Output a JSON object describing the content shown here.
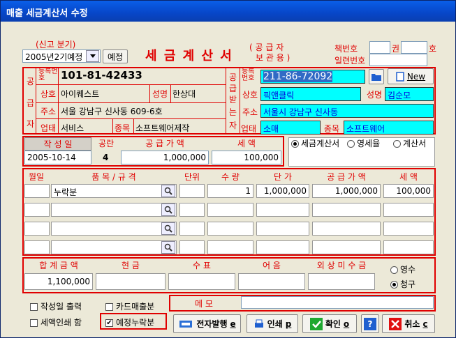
{
  "window": {
    "title": "매출 세금계산서 수정"
  },
  "report": {
    "label": "(신고 분기)",
    "period": "2005년2기예정",
    "button": "예정"
  },
  "doc": {
    "title": "세 금 계 산 서",
    "sub1": "( 공 급 자",
    "sub2": "보 관 용 )",
    "book_label": "책번호",
    "kwon": "권",
    "ho": "호",
    "serial_label": "일련번호"
  },
  "supplier": {
    "side": [
      "공",
      "급",
      "자"
    ],
    "regno_label": "등록번호",
    "regno": "101-81-42433",
    "trade_label": "상호",
    "trade": "아이퀘스트",
    "name_label": "성명",
    "name": "한상대",
    "addr_label": "주소",
    "addr": "서울 강남구 신사동 609-6호",
    "biz_label": "업태",
    "biz": "서비스",
    "item_label": "종목",
    "item": "소프트웨어제작"
  },
  "buyer": {
    "side": [
      "공",
      "급",
      "받",
      "는",
      "자"
    ],
    "regno_label": "등록번호",
    "regno": "211-86-72092",
    "new_button": "New",
    "trade_label": "상호",
    "trade": "픽앤클릭",
    "name_label": "성명",
    "name": "김순모",
    "addr_label": "주소",
    "addr": "서울시 강남구 신사동",
    "biz_label": "업태",
    "biz": "소매",
    "item_label": "종목",
    "item": "소프트웨어"
  },
  "summary": {
    "date_label": "작 성 일",
    "date": "2005-10-14",
    "blank_label": "공란",
    "blank": "4",
    "supply_label": "공 급 가 액",
    "supply": "1,000,000",
    "tax_label": "세 액",
    "tax": "100,000",
    "type_options": [
      "세금계산서",
      "영세율",
      "계산서"
    ]
  },
  "items": {
    "headers": [
      "월일",
      "품 목 / 규 격",
      "단위",
      "수 량",
      "단 가",
      "공 급 가 액",
      "세 액"
    ],
    "rows": [
      {
        "item": "누락분",
        "qty": "1",
        "price": "1,000,000",
        "supply": "1,000,000",
        "tax": "100,000"
      }
    ]
  },
  "totals": {
    "headers": [
      "합 계 금 액",
      "현 금",
      "수 표",
      "어 음",
      "외 상 미 수 금"
    ],
    "total": "1,100,000",
    "payment_options": [
      "영수",
      "청구"
    ]
  },
  "options": {
    "check1": "작성일 출력",
    "check2": "카드매출분",
    "check3": "세액인쇄 함",
    "check4": "예정누락분",
    "memo_label": "메 모"
  },
  "buttons": {
    "ebill": "전자발행",
    "print": "인쇄",
    "ok": "확인",
    "help": "?",
    "cancel": "취소"
  },
  "hotkeys": {
    "ebill": "e",
    "print": "p",
    "ok": "o",
    "cancel": "c"
  }
}
